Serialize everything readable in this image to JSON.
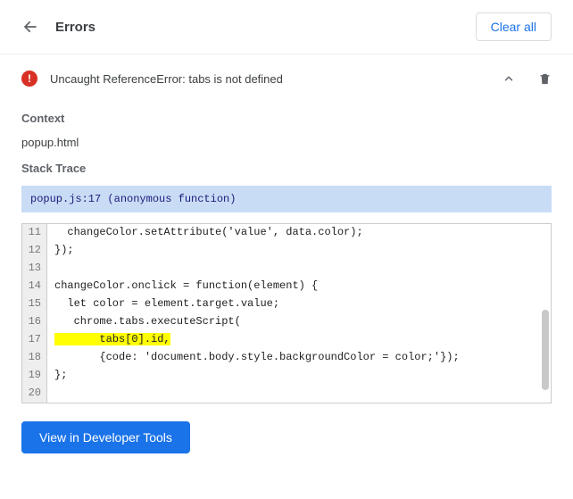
{
  "header": {
    "title": "Errors",
    "clear_label": "Clear all"
  },
  "error": {
    "message": "Uncaught ReferenceError: tabs is not defined"
  },
  "context": {
    "label": "Context",
    "value": "popup.html"
  },
  "stack": {
    "label": "Stack Trace",
    "frame": "popup.js:17 (anonymous function)"
  },
  "code": {
    "lines": [
      {
        "n": "11",
        "text": "  changeColor.setAttribute('value', data.color);",
        "hl": false
      },
      {
        "n": "12",
        "text": "});",
        "hl": false
      },
      {
        "n": "13",
        "text": "",
        "hl": false
      },
      {
        "n": "14",
        "text": "changeColor.onclick = function(element) {",
        "hl": false
      },
      {
        "n": "15",
        "text": "  let color = element.target.value;",
        "hl": false
      },
      {
        "n": "16",
        "text": "   chrome.tabs.executeScript(",
        "hl": false
      },
      {
        "n": "17",
        "text": "       tabs[0].id,",
        "hl": true
      },
      {
        "n": "18",
        "text": "       {code: 'document.body.style.backgroundColor = color;'});",
        "hl": false
      },
      {
        "n": "19",
        "text": "};",
        "hl": false
      },
      {
        "n": "20",
        "text": "",
        "hl": false
      }
    ]
  },
  "devtools": {
    "label": "View in Developer Tools"
  }
}
